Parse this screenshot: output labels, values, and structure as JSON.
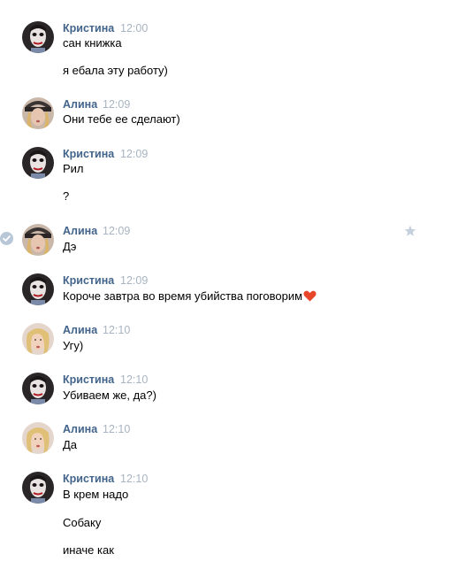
{
  "messages": [
    {
      "author": "Кристина",
      "time": "12:00",
      "lines": [
        "сан книжка",
        "я ебала эту работу)"
      ]
    },
    {
      "author": "Алина",
      "time": "12:09",
      "lines": [
        "Они тебе ее сделают)"
      ]
    },
    {
      "author": "Кристина",
      "time": "12:09",
      "lines": [
        "Рил",
        "?"
      ]
    },
    {
      "author": "Алина",
      "time": "12:09",
      "lines": [
        "Дэ"
      ]
    },
    {
      "author": "Кристина",
      "time": "12:09",
      "lines": [
        "Короче завтра во время убийства поговорим"
      ]
    },
    {
      "author": "Алина",
      "time": "12:10",
      "lines": [
        "Угу)"
      ]
    },
    {
      "author": "Кристина",
      "time": "12:10",
      "lines": [
        "Убиваем же, да?)"
      ]
    },
    {
      "author": "Алина",
      "time": "12:10",
      "lines": [
        "Да"
      ]
    },
    {
      "author": "Кристина",
      "time": "12:10",
      "lines": [
        "В крем надо",
        "Собаку",
        "иначе как"
      ]
    }
  ],
  "colors": {
    "author": "#42648b",
    "time": "#a8b4c2",
    "selected_check": "#b8c7d8",
    "star": "#c5d0dc",
    "heart": "#e8462a"
  },
  "icons": {
    "selected": "check-circle-icon",
    "favorite": "star-icon",
    "emoji": "heart-emoji-icon"
  }
}
